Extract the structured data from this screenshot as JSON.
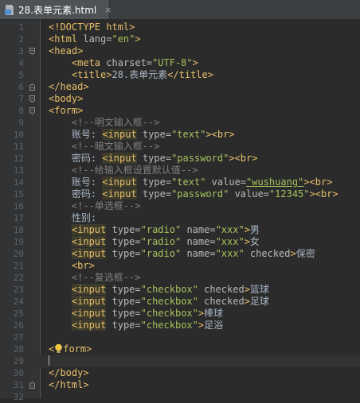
{
  "tab": {
    "title": "28.表单元素.html",
    "close": "×"
  },
  "lines": [
    {
      "n": "1",
      "segs": [
        [
          "t",
          "<!DOCTYPE html>"
        ]
      ]
    },
    {
      "n": "2",
      "segs": [
        [
          "t",
          "<html "
        ],
        [
          "a",
          "lang="
        ],
        [
          "s",
          "\"en\""
        ],
        [
          "t",
          ">"
        ]
      ]
    },
    {
      "n": "3",
      "segs": [
        [
          "t",
          "<head>"
        ]
      ]
    },
    {
      "n": "4",
      "segs": [
        [
          "p",
          "    "
        ],
        [
          "t",
          "<meta "
        ],
        [
          "a",
          "charset="
        ],
        [
          "s",
          "\"UTF-8\""
        ],
        [
          "t",
          ">"
        ]
      ]
    },
    {
      "n": "5",
      "segs": [
        [
          "p",
          "    "
        ],
        [
          "t",
          "<title>"
        ],
        [
          "p",
          "28.表单元素"
        ],
        [
          "t",
          "</title>"
        ]
      ]
    },
    {
      "n": "6",
      "segs": [
        [
          "t",
          "</head>"
        ]
      ]
    },
    {
      "n": "7",
      "segs": [
        [
          "t",
          "<body>"
        ]
      ]
    },
    {
      "n": "8",
      "segs": [
        [
          "t",
          "<form>"
        ]
      ]
    },
    {
      "n": "9",
      "segs": [
        [
          "p",
          "    "
        ],
        [
          "c",
          "<!--明文输入框-->"
        ]
      ]
    },
    {
      "n": "10",
      "segs": [
        [
          "p",
          "    账号: "
        ],
        [
          "th",
          "<input"
        ],
        [
          "p",
          " "
        ],
        [
          "a",
          "type="
        ],
        [
          "s",
          "\"text\""
        ],
        [
          "t",
          ">"
        ],
        [
          "t",
          "<br>"
        ]
      ]
    },
    {
      "n": "11",
      "segs": [
        [
          "p",
          "    "
        ],
        [
          "c",
          "<!--暗文输入框-->"
        ]
      ]
    },
    {
      "n": "12",
      "segs": [
        [
          "p",
          "    密码: "
        ],
        [
          "th",
          "<input"
        ],
        [
          "p",
          " "
        ],
        [
          "a",
          "type="
        ],
        [
          "s",
          "\"password\""
        ],
        [
          "t",
          ">"
        ],
        [
          "t",
          "<br>"
        ]
      ]
    },
    {
      "n": "13",
      "segs": [
        [
          "p",
          "    "
        ],
        [
          "c",
          "<!--给输入框设置默认值-->"
        ]
      ]
    },
    {
      "n": "14",
      "segs": [
        [
          "p",
          "    账号: "
        ],
        [
          "th",
          "<input"
        ],
        [
          "p",
          " "
        ],
        [
          "a",
          "type="
        ],
        [
          "s",
          "\"text\""
        ],
        [
          "p",
          " "
        ],
        [
          "a",
          "value="
        ],
        [
          "su",
          "\"wushuang\""
        ],
        [
          "t",
          ">"
        ],
        [
          "t",
          "<br>"
        ]
      ]
    },
    {
      "n": "15",
      "segs": [
        [
          "p",
          "    密码: "
        ],
        [
          "th",
          "<input"
        ],
        [
          "p",
          " "
        ],
        [
          "a",
          "type="
        ],
        [
          "s",
          "\"password\""
        ],
        [
          "p",
          " "
        ],
        [
          "a",
          "value="
        ],
        [
          "s",
          "\"12345\""
        ],
        [
          "t",
          ">"
        ],
        [
          "t",
          "<br>"
        ]
      ]
    },
    {
      "n": "16",
      "segs": [
        [
          "p",
          "    "
        ],
        [
          "c",
          "<!--单选框-->"
        ]
      ]
    },
    {
      "n": "17",
      "segs": [
        [
          "p",
          "    性别:"
        ]
      ]
    },
    {
      "n": "18",
      "segs": [
        [
          "p",
          "    "
        ],
        [
          "th",
          "<input"
        ],
        [
          "p",
          " "
        ],
        [
          "a",
          "type="
        ],
        [
          "s",
          "\"radio\""
        ],
        [
          "p",
          " "
        ],
        [
          "a",
          "name="
        ],
        [
          "s",
          "\"xxx\""
        ],
        [
          "t",
          ">"
        ],
        [
          "p",
          "男"
        ]
      ]
    },
    {
      "n": "19",
      "segs": [
        [
          "p",
          "    "
        ],
        [
          "th",
          "<input"
        ],
        [
          "p",
          " "
        ],
        [
          "a",
          "type="
        ],
        [
          "s",
          "\"radio\""
        ],
        [
          "p",
          " "
        ],
        [
          "a",
          "name="
        ],
        [
          "s",
          "\"xxx\""
        ],
        [
          "t",
          ">"
        ],
        [
          "p",
          "女"
        ]
      ]
    },
    {
      "n": "20",
      "segs": [
        [
          "p",
          "    "
        ],
        [
          "th",
          "<input"
        ],
        [
          "p",
          " "
        ],
        [
          "a",
          "type="
        ],
        [
          "s",
          "\"radio\""
        ],
        [
          "p",
          " "
        ],
        [
          "a",
          "name="
        ],
        [
          "s",
          "\"xxx\""
        ],
        [
          "p",
          " "
        ],
        [
          "a",
          "checked"
        ],
        [
          "t",
          ">"
        ],
        [
          "p",
          "保密"
        ]
      ]
    },
    {
      "n": "21",
      "segs": [
        [
          "p",
          "    "
        ],
        [
          "t",
          "<br>"
        ]
      ]
    },
    {
      "n": "22",
      "segs": [
        [
          "p",
          "    "
        ],
        [
          "c",
          "<!--复选框-->"
        ]
      ]
    },
    {
      "n": "23",
      "segs": [
        [
          "p",
          "    "
        ],
        [
          "th",
          "<input"
        ],
        [
          "p",
          " "
        ],
        [
          "a",
          "type="
        ],
        [
          "s",
          "\"checkbox\""
        ],
        [
          "p",
          " "
        ],
        [
          "a",
          "checked"
        ],
        [
          "t",
          ">"
        ],
        [
          "p",
          "篮球"
        ]
      ]
    },
    {
      "n": "24",
      "segs": [
        [
          "p",
          "    "
        ],
        [
          "th",
          "<input"
        ],
        [
          "p",
          " "
        ],
        [
          "a",
          "type="
        ],
        [
          "s",
          "\"checkbox\""
        ],
        [
          "p",
          " "
        ],
        [
          "a",
          "checked"
        ],
        [
          "t",
          ">"
        ],
        [
          "p",
          "足球"
        ]
      ]
    },
    {
      "n": "25",
      "segs": [
        [
          "p",
          "    "
        ],
        [
          "th",
          "<input"
        ],
        [
          "p",
          " "
        ],
        [
          "a",
          "type="
        ],
        [
          "s",
          "\"checkbox\""
        ],
        [
          "t",
          ">"
        ],
        [
          "p",
          "棒球"
        ]
      ]
    },
    {
      "n": "26",
      "segs": [
        [
          "p",
          "    "
        ],
        [
          "th",
          "<input"
        ],
        [
          "p",
          " "
        ],
        [
          "a",
          "type="
        ],
        [
          "s",
          "\"checkbox\""
        ],
        [
          "t",
          ">"
        ],
        [
          "p",
          "足浴"
        ]
      ]
    },
    {
      "n": "27",
      "segs": []
    },
    {
      "n": "28",
      "segs": [
        [
          "t",
          "<"
        ],
        [
          "bulb",
          ""
        ],
        [
          "t",
          "form>"
        ]
      ]
    },
    {
      "n": "29",
      "segs": [
        [
          "caret",
          ""
        ]
      ],
      "current": true
    },
    {
      "n": "30",
      "segs": [
        [
          "t",
          "</body>"
        ]
      ]
    },
    {
      "n": "31",
      "segs": [
        [
          "t",
          "</html>"
        ]
      ]
    },
    {
      "n": "32",
      "segs": []
    }
  ],
  "folds": {
    "3": "open",
    "6": "close",
    "7": "open",
    "8": "open",
    "31": "close"
  },
  "colors": {
    "bg": "#2b2b2b",
    "gutter": "#313335",
    "tag": "#e8bf6a",
    "string": "#a5c25c",
    "comment": "#808080",
    "attr": "#bababa"
  }
}
